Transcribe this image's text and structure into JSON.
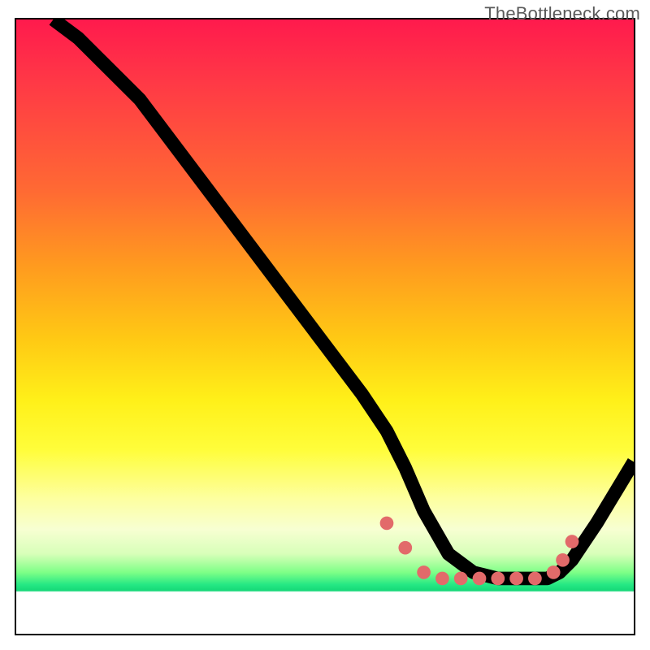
{
  "watermark": "TheBottleneck.com",
  "chart_data": {
    "type": "line",
    "title": "",
    "xlabel": "",
    "ylabel": "",
    "xlim": [
      0,
      100
    ],
    "ylim": [
      0,
      100
    ],
    "grid": false,
    "legend": false,
    "background_gradient": {
      "stops": [
        {
          "pos": 0.0,
          "color": "#ff1a4d"
        },
        {
          "pos": 0.4,
          "color": "#ff9a1f"
        },
        {
          "pos": 0.62,
          "color": "#fff019"
        },
        {
          "pos": 0.83,
          "color": "#f7ffd2"
        },
        {
          "pos": 0.92,
          "color": "#25e884"
        },
        {
          "pos": 0.93,
          "color": "#ffffff"
        }
      ]
    },
    "series": [
      {
        "name": "bottleneck-curve",
        "x": [
          6,
          10,
          14,
          20,
          26,
          32,
          38,
          44,
          50,
          56,
          60,
          63,
          66,
          70,
          74,
          78,
          82,
          86,
          88,
          90,
          94,
          100
        ],
        "y": [
          100,
          97,
          93,
          87,
          79,
          71,
          63,
          55,
          47,
          39,
          33,
          27,
          20,
          13,
          10,
          9,
          9,
          9,
          10,
          12,
          18,
          28
        ]
      }
    ],
    "markers": {
      "name": "highlight-dots",
      "color": "#e26a6a",
      "points": [
        {
          "x": 60,
          "y": 18
        },
        {
          "x": 63,
          "y": 14
        },
        {
          "x": 66,
          "y": 10
        },
        {
          "x": 69,
          "y": 9
        },
        {
          "x": 72,
          "y": 9
        },
        {
          "x": 75,
          "y": 9
        },
        {
          "x": 78,
          "y": 9
        },
        {
          "x": 81,
          "y": 9
        },
        {
          "x": 84,
          "y": 9
        },
        {
          "x": 87,
          "y": 10
        },
        {
          "x": 88.5,
          "y": 12
        },
        {
          "x": 90,
          "y": 15
        }
      ]
    }
  }
}
